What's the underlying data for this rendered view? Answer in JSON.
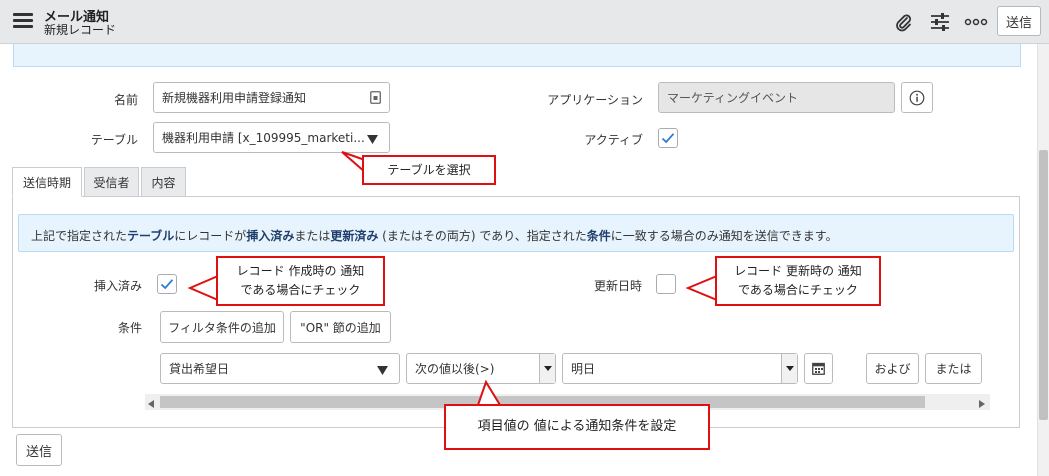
{
  "header": {
    "title": "メール通知",
    "subtitle": "新規レコード",
    "send_label": "送信",
    "icons": [
      "paperclip-icon",
      "sliders-icon",
      "more-icon"
    ]
  },
  "form": {
    "name_label": "名前",
    "name_value": "新規機器利用申請登録通知",
    "table_label": "テーブル",
    "table_value": "機器利用申請 [x_109995_marketi...",
    "application_label": "アプリケーション",
    "application_value": "マーケティングイベント",
    "active_label": "アクティブ",
    "active_checked": true
  },
  "tabs": [
    {
      "label": "送信時期",
      "active": true
    },
    {
      "label": "受信者",
      "active": false
    },
    {
      "label": "内容",
      "active": false
    }
  ],
  "when": {
    "note_parts": [
      "上記で指定された",
      "テーブル",
      "にレコードが",
      "挿入済み",
      "または",
      "更新済み",
      " (またはその両方) であり、指定された",
      "条件",
      "に一致する場合のみ通知を送信できます。"
    ],
    "inserted_label": "挿入済み",
    "inserted_checked": true,
    "updated_label": "更新日時",
    "updated_checked": false,
    "condition_label": "条件",
    "add_filter_label": "フィルタ条件の追加",
    "add_or_label": "\"OR\" 節の追加",
    "field_value": "貸出希望日",
    "operator_value": "次の値以後(>)",
    "value_value": "明日",
    "and_label": "および",
    "or_label": "または"
  },
  "footer": {
    "send_label": "送信"
  },
  "callouts": {
    "table": "テーブルを選択",
    "inserted": "レコード 作成時の 通知\nである場合にチェック",
    "updated": "レコード 更新時の 通知\nである場合にチェック",
    "condition": "項目値の 値による通知条件を設定"
  },
  "colors": {
    "accent": "#2b7bd6",
    "callout_border": "#e01010",
    "note_bg": "#e8f4fd"
  }
}
